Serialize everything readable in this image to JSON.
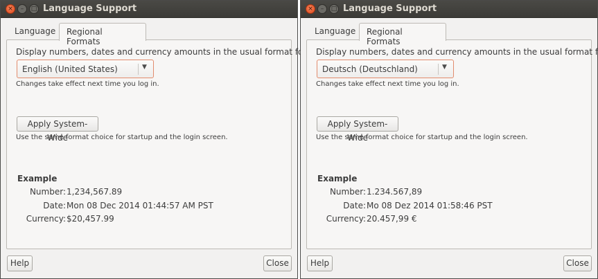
{
  "windows": [
    {
      "title": "Language Support",
      "controls": {
        "close": "×",
        "minimize": "–",
        "maximize": "□"
      },
      "tabs": [
        {
          "label": "Language"
        },
        {
          "label": "Regional Formats"
        }
      ],
      "active_tab": "Regional Formats",
      "prompt": "Display numbers, dates and currency amounts in the usual format for:",
      "format_select": {
        "value": "English (United States)",
        "arrow": "▼"
      },
      "note": "Changes take effect next time you log in.",
      "apply_label": "Apply System-Wide",
      "apply_note": "Use the same format choice for startup and the login screen.",
      "example": {
        "heading": "Example",
        "number_label": "Number:",
        "number_value": "1,234,567.89",
        "date_label": "Date:",
        "date_value": "Mon 08 Dec 2014 01:44:57 AM PST",
        "currency_label": "Currency:",
        "currency_value": "$20,457.99"
      },
      "help_label": "Help",
      "close_label": "Close"
    },
    {
      "title": "Language Support",
      "controls": {
        "close": "×",
        "minimize": "–",
        "maximize": "□"
      },
      "tabs": [
        {
          "label": "Language"
        },
        {
          "label": "Regional Formats"
        }
      ],
      "active_tab": "Regional Formats",
      "prompt": "Display numbers, dates and currency amounts in the usual format for:",
      "format_select": {
        "value": "Deutsch (Deutschland)",
        "arrow": "▼"
      },
      "note": "Changes take effect next time you log in.",
      "apply_label": "Apply System-Wide",
      "apply_note": "Use the same format choice for startup and the login screen.",
      "example": {
        "heading": "Example",
        "number_label": "Number:",
        "number_value": "1.234.567,89",
        "date_label": "Date:",
        "date_value": "Mo 08 Dez 2014 01:58:46 PST",
        "currency_label": "Currency:",
        "currency_value": "20.457,99 €"
      },
      "help_label": "Help",
      "close_label": "Close"
    }
  ],
  "colors": {
    "titlebar": "#3c3b37",
    "title_text": "#dfdbd2",
    "close_button": "#e0481b",
    "combo_focus_border": "#e28b6c",
    "window_bg": "#f2f1f0"
  }
}
